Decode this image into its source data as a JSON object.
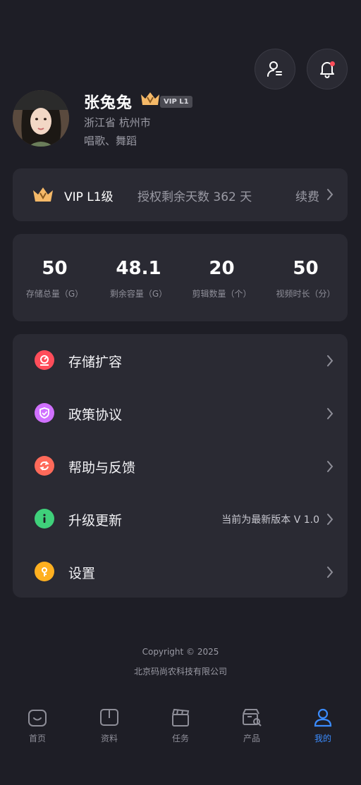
{
  "header": {
    "profile_button": "user-settings-icon",
    "notification_button": "bell-icon",
    "notification_dot_color": "#ff4d5a"
  },
  "user": {
    "name": "张兔兔",
    "vip_badge": "VIP L1",
    "location": "浙江省 杭州市",
    "hobbies": "唱歌、舞蹈"
  },
  "vip": {
    "level": "VIP L1级",
    "remaining": "授权剩余天数 362 天",
    "renew": "续费",
    "crown_color": "#f5b968"
  },
  "stats": [
    {
      "value": "50",
      "label": "存储总量（G）"
    },
    {
      "value": "48.1",
      "label": "剩余容量（G）"
    },
    {
      "value": "20",
      "label": "剪辑数量（个）"
    },
    {
      "value": "50",
      "label": "视频时长（分）"
    }
  ],
  "menu": [
    {
      "label": "存储扩容",
      "icon": "storage-icon",
      "color": "#ff4d5a",
      "extra": ""
    },
    {
      "label": "政策协议",
      "icon": "shield-icon",
      "color": "#d070ff",
      "extra": ""
    },
    {
      "label": "帮助与反馈",
      "icon": "refresh-icon",
      "color": "#ff6a5a",
      "extra": ""
    },
    {
      "label": "升级更新",
      "icon": "info-icon",
      "color": "#3fd07a",
      "extra": "当前为最新版本  V 1.0"
    },
    {
      "label": "设置",
      "icon": "settings-shield-icon",
      "color": "#ffb020",
      "extra": ""
    }
  ],
  "footer": {
    "copyright": "Copyright © 2025",
    "company": "北京码尚农科技有限公司"
  },
  "tabs": [
    {
      "label": "首页",
      "icon": "home-icon"
    },
    {
      "label": "资料",
      "icon": "book-icon"
    },
    {
      "label": "任务",
      "icon": "clapper-icon"
    },
    {
      "label": "产品",
      "icon": "product-search-icon"
    },
    {
      "label": "我的",
      "icon": "user-icon",
      "active": true
    }
  ],
  "accent_color": "#3b8cff"
}
